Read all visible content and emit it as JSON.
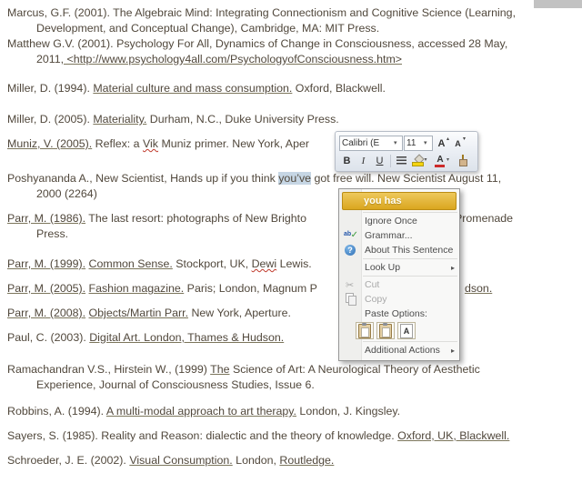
{
  "colors": {
    "document_text": "#51483c",
    "selection_highlight": "#c6d6e4",
    "suggestion_gold": "#d9a51e"
  },
  "document": {
    "paragraphs": [
      {
        "segments": [
          "Marcus, G.F. (2001). The Algebraic Mind: Integrating Connectionism and Cognitive Science (Learning,",
          "Development, and Conceptual Change), Cambridge, MA: MIT Press."
        ]
      },
      {
        "segments": [
          "Matthew G.V. (2001). Psychology For All, Dynamics of Change in Consciousness, accessed 28 May,",
          "2011",
          ", <http://www.psychology4all.com/PsychologyofConsciousness.htm>"
        ]
      },
      {
        "segments": [
          "Miller, D. (1994). ",
          "Material culture and mass consumption.",
          " Oxford, Blackwell."
        ]
      },
      {
        "segments": [
          "Miller, D. (2005). ",
          "Materiality.",
          " Durham, N.C., Duke University Press."
        ]
      },
      {
        "segments": [
          "Muniz, V. (2005).",
          " Reflex: a ",
          "Vik",
          " Muniz primer. New York, Aper"
        ]
      },
      {
        "segments": [
          "Poshyananda A., New Scientist, Hands up if you think ",
          "you’ve",
          " got free will. New Scientist August 11,",
          "2000 (2264)"
        ]
      },
      {
        "segments": [
          "Parr, M. (1986).",
          " The last resort: photographs of New Brighto",
          "Promenade",
          "Press."
        ]
      },
      {
        "segments": [
          "Parr, M. (1999).",
          " ",
          "Common Sense.",
          " Stockport, UK, ",
          "Dewi",
          " Lewis."
        ]
      },
      {
        "segments": [
          "Parr, M. (2005).",
          " ",
          "Fashion magazine.",
          " Paris; London, Magnum P",
          "dson."
        ]
      },
      {
        "segments": [
          "Parr, M. (2008).",
          " ",
          "Objects/Martin Parr.",
          " New York, Aperture."
        ]
      },
      {
        "segments": [
          "Paul, C. (2003). ",
          "Digital Art. London, Thames & Hudson."
        ]
      },
      {
        "segments": [
          "Ramachandran V.S., Hirstein W., (1999) ",
          "The",
          " Science of Art: A Neurological Theory of Aesthetic",
          "Experience, Journal of Consciousness Studies, Issue 6."
        ]
      },
      {
        "segments": [
          "Robbins, A. (1994). ",
          "A multi-modal approach to art therapy.",
          " London, J. Kingsley."
        ]
      },
      {
        "segments": [
          "Sayers, S. (1985). Reality and Reason: dialectic and the theory of knowledge. ",
          "Oxford, UK, Blackwell."
        ]
      },
      {
        "segments": [
          "Schroeder, J. E. (2002). ",
          "Visual Consumption.",
          " London, ",
          "Routledge."
        ]
      }
    ]
  },
  "mini_toolbar": {
    "font_name": "Calibri (E",
    "font_size": "11",
    "bold_label": "B",
    "italic_label": "I",
    "underline_label": "U",
    "grow_font_label": "A",
    "shrink_font_label": "A",
    "font_color_label": "A"
  },
  "context_menu": {
    "suggestion": "you has",
    "ignore_once": "Ignore Once",
    "grammar": "Grammar...",
    "about_this_sentence": "About This Sentence",
    "look_up": "Look Up",
    "cut": "Cut",
    "copy": "Copy",
    "paste_options_label": "Paste Options:",
    "additional_actions": "Additional Actions"
  }
}
